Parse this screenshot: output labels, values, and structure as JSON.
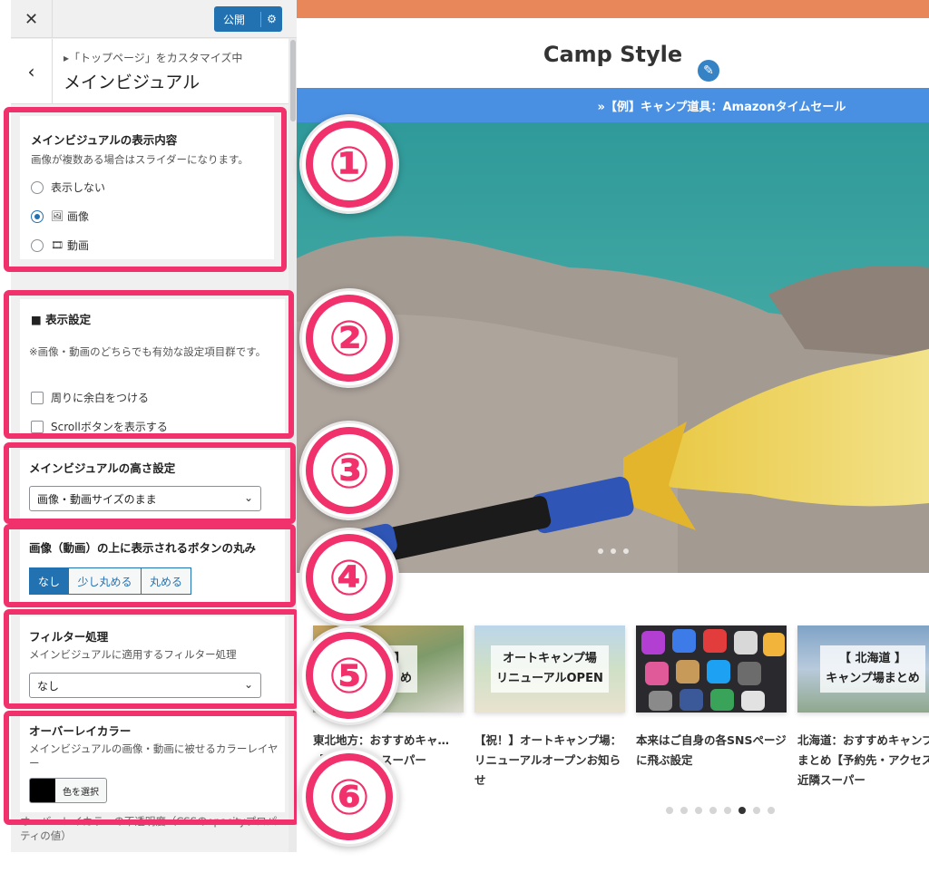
{
  "customizer": {
    "publish_label": "公開",
    "breadcrumb": "▸「トップページ」をカスタマイズ中",
    "section_title": "メインビジュアル",
    "display_content": {
      "title": "メインビジュアルの表示内容",
      "desc": "画像が複数ある場合はスライダーになります。",
      "options": [
        "表示しない",
        "画像",
        "動画"
      ],
      "selected": "画像"
    },
    "display_settings": {
      "title": "表示設定",
      "desc": "※画像・動画のどちらでも有効な設定項目群です。",
      "checkboxes": [
        "周りに余白をつける",
        "Scrollボタンを表示する"
      ]
    },
    "height_setting": {
      "title": "メインビジュアルの高さ設定",
      "value": "画像・動画サイズのまま"
    },
    "button_radius": {
      "title": "画像（動画）の上に表示されるボタンの丸み",
      "options": [
        "なし",
        "少し丸める",
        "丸める"
      ],
      "selected": "なし"
    },
    "filter": {
      "title": "フィルター処理",
      "desc": "メインビジュアルに適用するフィルター処理",
      "value": "なし"
    },
    "overlay": {
      "title": "オーバーレイカラー",
      "desc": "メインビジュアルの画像・動画に被せるカラーレイヤー",
      "button_label": "色を選択",
      "color": "#000000"
    },
    "cutoff_text": "オーバーレイカラーの不透明度（CSSのopacityプロパティの値）"
  },
  "preview": {
    "site_title": "Camp Style",
    "info_bar": "»【例】キャンプ道具：Amazonタイムセール",
    "cards": [
      {
        "caption": "…行】\n…まとめ",
        "title": "東北地方：おすすめキャ…【予約先・…スーパー"
      },
      {
        "caption": "オートキャンプ場\nリニューアルOPEN",
        "title": "【祝！】オートキャンプ場：リニューアルオープンお知らせ"
      },
      {
        "caption": "",
        "title": "本来はご自身の各SNSページに飛ぶ設定"
      },
      {
        "caption": "【 北海道 】\nキャンプ場まとめ",
        "title": "北海道：おすすめキャンプ場まとめ【予約先・アクセス・近隣スーパー"
      }
    ],
    "carousel_active": 6,
    "carousel_total": 8
  },
  "markers": [
    "①",
    "②",
    "③",
    "④",
    "⑤",
    "⑥"
  ],
  "colors": {
    "highlight": "#f0316b",
    "accent": "#2271b1",
    "info_bar": "#4a90e2",
    "top_bar": "#e8875a"
  }
}
